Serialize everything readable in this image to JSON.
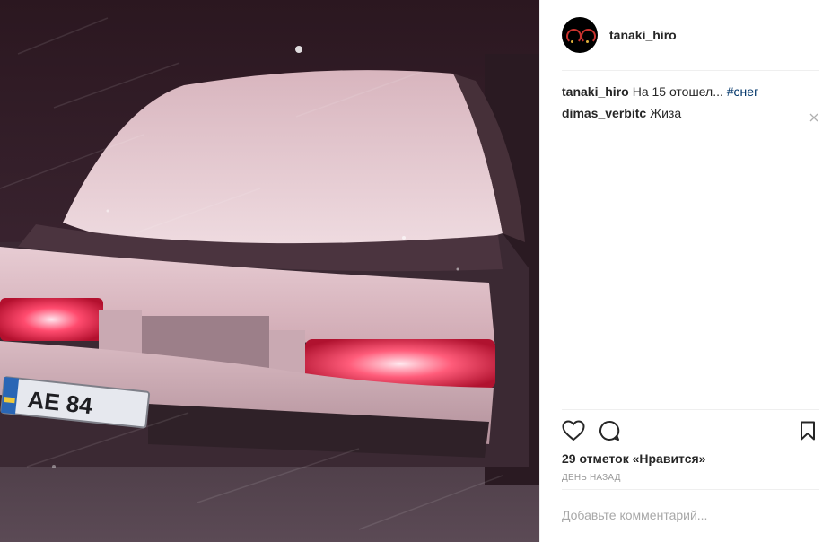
{
  "post": {
    "author": "tanaki_hiro",
    "photo_alt": "snow covered car at night"
  },
  "comments": [
    {
      "author": "tanaki_hiro",
      "text": "На 15 отошел...",
      "tag": "#снег"
    },
    {
      "author": "dimas_verbitc",
      "text": "Жиза",
      "tag": ""
    }
  ],
  "actions": {
    "like_icon": "heart-icon",
    "comment_icon": "comment-bubble-icon",
    "save_icon": "bookmark-icon"
  },
  "likes_text": "29 отметок «Нравится»",
  "time_text": "день назад",
  "comment_input": {
    "placeholder": "Добавьте комментарий...",
    "value": ""
  },
  "colors": {
    "text": "#262626",
    "muted": "#999999",
    "hashtag": "#003569",
    "divider": "#efefef"
  }
}
